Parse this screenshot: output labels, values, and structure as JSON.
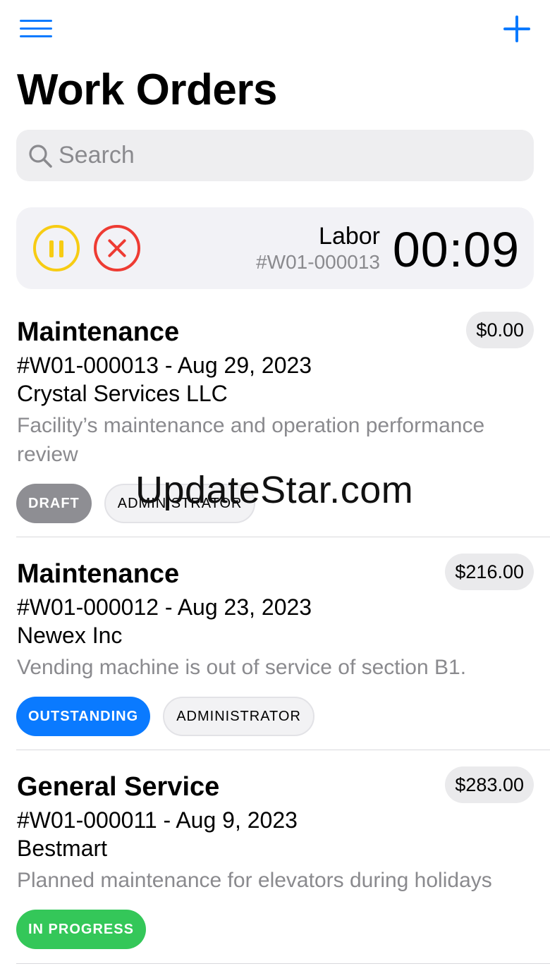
{
  "header": {
    "title": "Work Orders"
  },
  "search": {
    "placeholder": "Search"
  },
  "timer": {
    "label": "Labor",
    "reference": "#W01-000013",
    "elapsed": "00:09"
  },
  "orders": [
    {
      "title": "Maintenance",
      "price": "$0.00",
      "reference": "#W01-000013 - Aug 29, 2023",
      "customer": "Crystal Services LLC",
      "description": "Facility’s maintenance and operation performance review",
      "status": "DRAFT",
      "role": "ADMINISTRATOR"
    },
    {
      "title": "Maintenance",
      "price": "$216.00",
      "reference": "#W01-000012 - Aug 23, 2023",
      "customer": "Newex Inc",
      "description": "Vending machine is out of service of section B1.",
      "status": "OUTSTANDING",
      "role": "ADMINISTRATOR"
    },
    {
      "title": "General Service",
      "price": "$283.00",
      "reference": "#W01-000011 - Aug 9, 2023",
      "customer": "Bestmart",
      "description": "Planned maintenance for elevators during holidays",
      "status": "IN PROGRESS"
    }
  ],
  "watermark": "UpdateStar.com",
  "colors": {
    "accent": "#0a7aff",
    "pause": "#f7cc13",
    "cancel": "#ee3b33",
    "draft": "#8e8e93",
    "outstanding": "#0a7aff",
    "in_progress": "#34c759"
  },
  "icons": {
    "menu": "hamburger-menu-icon",
    "add": "plus-icon",
    "search": "search-icon",
    "pause": "pause-icon",
    "cancel": "close-circle-icon"
  }
}
